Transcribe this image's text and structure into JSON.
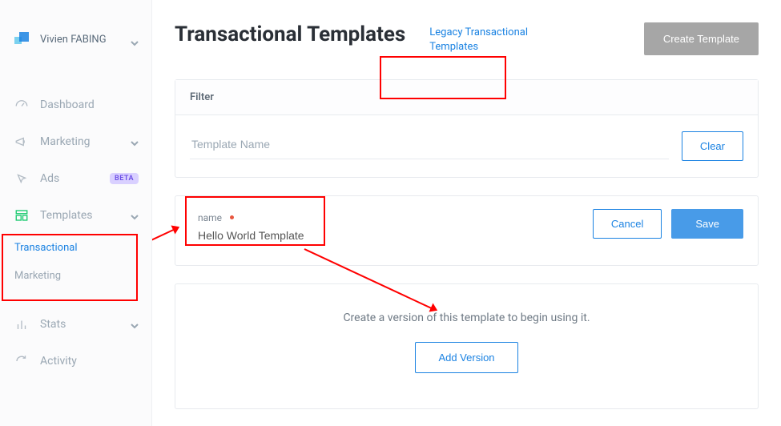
{
  "user_name": "Vivien FABING",
  "sidebar": {
    "items": [
      {
        "label": "Dashboard"
      },
      {
        "label": "Marketing"
      },
      {
        "label": "Ads",
        "badge": "BETA"
      },
      {
        "label": "Templates"
      },
      {
        "label": "Stats"
      },
      {
        "label": "Activity"
      }
    ],
    "sub_items": [
      {
        "label": "Transactional"
      },
      {
        "label": "Marketing"
      }
    ]
  },
  "header": {
    "title": "Transactional Templates",
    "legacy_link": "Legacy Transactional Templates",
    "create_button": "Create Template"
  },
  "filter": {
    "header": "Filter",
    "placeholder": "Template Name",
    "clear_button": "Clear"
  },
  "name_panel": {
    "label": "name",
    "value": "Hello World Template",
    "cancel": "Cancel",
    "save": "Save"
  },
  "version_panel": {
    "text": "Create a version of this template to begin using it.",
    "button": "Add Version"
  }
}
